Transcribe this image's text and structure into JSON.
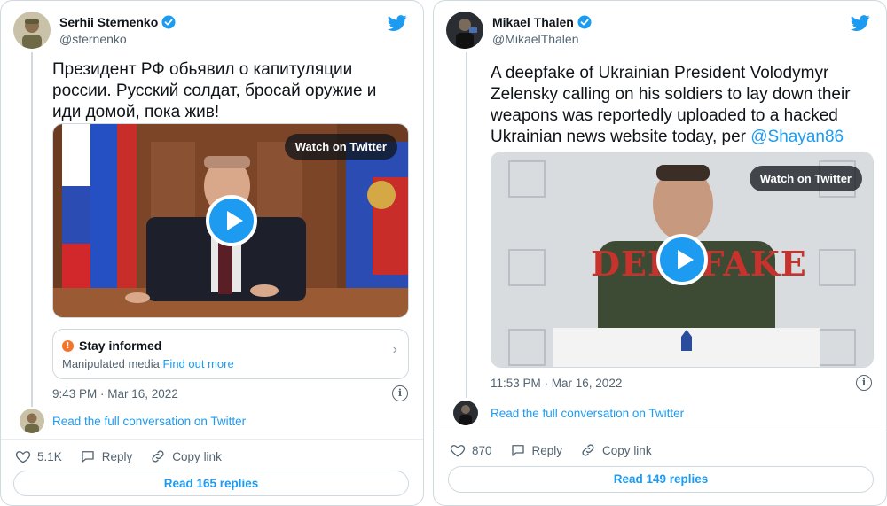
{
  "left": {
    "author": {
      "name": "Serhii Sternenko",
      "handle": "@sternenko"
    },
    "text": "Президент РФ обьявил о капитуляции россии. Русский солдат, бросай оружие и иди домой, пока жив!",
    "media": {
      "watch_label": "Watch on Twitter"
    },
    "stay_informed": {
      "title": "Stay informed",
      "subtitle": "Manipulated media",
      "link": "Find out more"
    },
    "timestamp": "9:43 PM · Mar 16, 2022",
    "read_conversation": "Read the full conversation on Twitter",
    "actions": {
      "likes": "5.1K",
      "reply": "Reply",
      "copy": "Copy link"
    },
    "replies_button": "Read 165 replies"
  },
  "right": {
    "author": {
      "name": "Mikael Thalen",
      "handle": "@MikaelThalen"
    },
    "text": "A deepfake of Ukrainian President Volodymyr Zelensky calling on his soldiers to lay down their weapons was reportedly uploaded to a hacked Ukrainian news website today, per",
    "mention": "@Shayan86",
    "media": {
      "watch_label": "Watch on Twitter",
      "overlay_text": "DEEPFAKE"
    },
    "timestamp": "11:53 PM · Mar 16, 2022",
    "read_conversation": "Read the full conversation on Twitter",
    "actions": {
      "likes": "870",
      "reply": "Reply",
      "copy": "Copy link"
    },
    "replies_button": "Read 149 replies"
  },
  "colors": {
    "accent": "#1d9bf0",
    "border": "#cfd9de",
    "muted": "#536471",
    "warning": "#f4742c"
  },
  "icons": [
    "verified-badge-icon",
    "twitter-bird-icon",
    "play-icon",
    "warning-icon",
    "info-icon",
    "heart-icon",
    "reply-icon",
    "link-icon",
    "chevron-right-icon"
  ]
}
